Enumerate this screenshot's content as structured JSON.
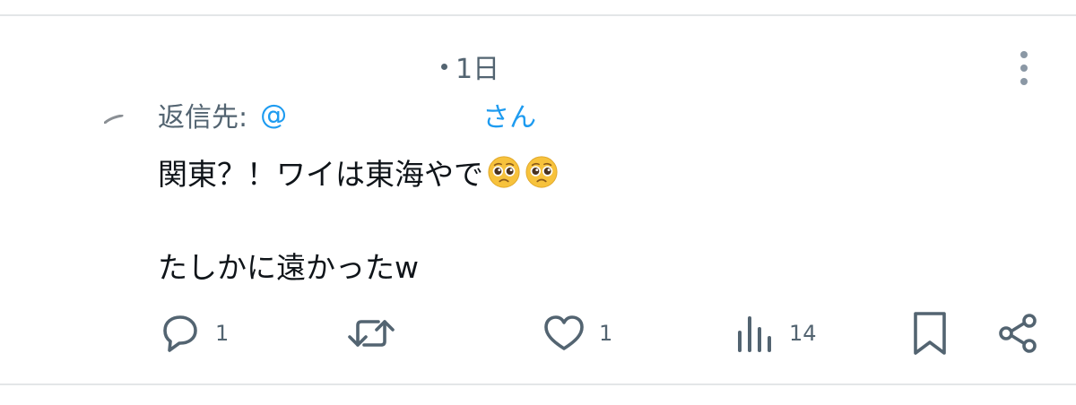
{
  "tweet": {
    "time": "1日",
    "reply_label": "返信先:",
    "reply_at": "@",
    "reply_suffix": "さん",
    "line1": "関東？！ワイは東海やで",
    "line2": "たしかに遠かったw",
    "emoji": "pleading-face"
  },
  "actions": {
    "reply_count": "1",
    "like_count": "1",
    "views_count": "14"
  },
  "colors": {
    "text": "#0f1419",
    "secondary": "#536471",
    "link": "#1d9bf0",
    "divider": "#e3e6e8"
  }
}
